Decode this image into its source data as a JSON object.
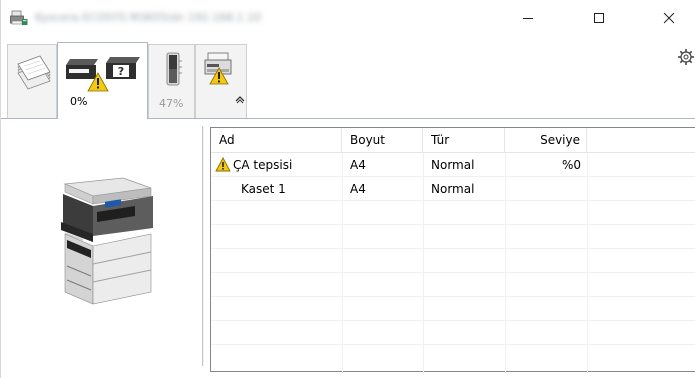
{
  "window": {
    "title": "Kyocera ECOSYS M3655idn 192.168.1.10"
  },
  "titlebar_buttons": {
    "minimize": "—",
    "maximize": "☐",
    "close": "✕"
  },
  "tabs": [
    {
      "label": "",
      "icon": "paper-stack-icon"
    },
    {
      "label": "0%",
      "icon": "tray-warning-icon",
      "active": true
    },
    {
      "label": "47%",
      "icon": "toner-icon"
    },
    {
      "label": "",
      "icon": "printer-warning-icon"
    }
  ],
  "icons": {
    "collapse": "chevron-up-icon",
    "settings": "gear-icon",
    "warning_color": "#f2c811",
    "accent": "#1f5aa6"
  },
  "table": {
    "columns": [
      "Ad",
      "Boyut",
      "Tür",
      "Seviye"
    ],
    "rows": [
      {
        "ad": "ÇA tepsisi",
        "boyut": "A4",
        "tur": "Normal",
        "seviye": "%0",
        "warning": true
      },
      {
        "ad": "Kaset 1",
        "boyut": "A4",
        "tur": "Normal",
        "seviye": "",
        "warning": false
      }
    ]
  }
}
